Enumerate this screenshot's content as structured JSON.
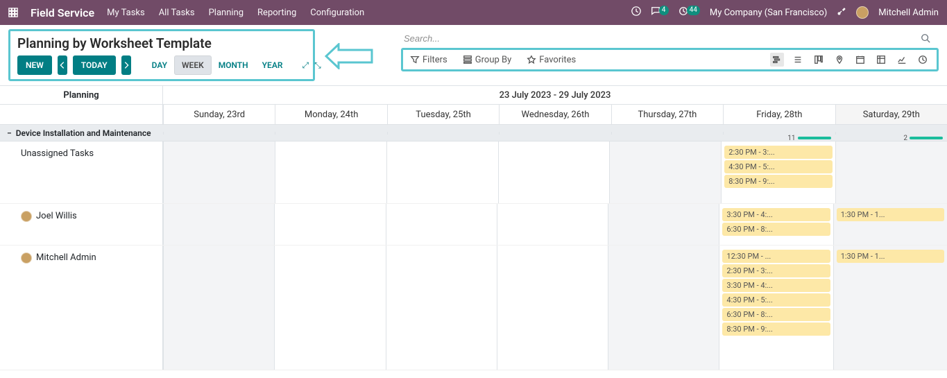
{
  "nav": {
    "brand": "Field Service",
    "menu": [
      "My Tasks",
      "All Tasks",
      "Planning",
      "Reporting",
      "Configuration"
    ],
    "messages_badge": "4",
    "activities_badge": "44",
    "company": "My Company (San Francisco)",
    "user": "Mitchell Admin"
  },
  "page": {
    "title": "Planning by Worksheet Template",
    "new_label": "NEW",
    "today_label": "TODAY",
    "scales": {
      "day": "DAY",
      "week": "WEEK",
      "month": "MONTH",
      "year": "YEAR"
    }
  },
  "search": {
    "placeholder": "Search...",
    "filters": "Filters",
    "groupby": "Group By",
    "favorites": "Favorites"
  },
  "gantt": {
    "side_title": "Planning",
    "range": "23 July 2023 - 29 July 2023",
    "days": [
      "Sunday, 23rd",
      "Monday, 24th",
      "Tuesday, 25th",
      "Wednesday, 26th",
      "Thursday, 27th",
      "Friday, 28th",
      "Saturday, 29th"
    ],
    "group": {
      "name": "Device Installation and Maintenance",
      "fri_count": "11",
      "sat_count": "2"
    },
    "rows": [
      {
        "name": "Unassigned Tasks",
        "avatar": false,
        "fri": [
          "2:30 PM - 3:...",
          "4:30 PM - 5:...",
          "8:30 PM - 9:..."
        ],
        "sat": []
      },
      {
        "name": "Joel Willis",
        "avatar": true,
        "sun_highlight": true,
        "fri": [
          "3:30 PM - 4:...",
          "6:30 PM - 8:..."
        ],
        "sat": [
          "1:30 PM - 1..."
        ]
      },
      {
        "name": "Mitchell Admin",
        "avatar": true,
        "fri": [
          "12:30 PM - ...",
          "2:30 PM - 3:...",
          "3:30 PM - 4:...",
          "4:30 PM - 5:...",
          "6:30 PM - 8:...",
          "8:30 PM - 9:..."
        ],
        "sat": [
          "1:30 PM - 1..."
        ]
      }
    ]
  }
}
